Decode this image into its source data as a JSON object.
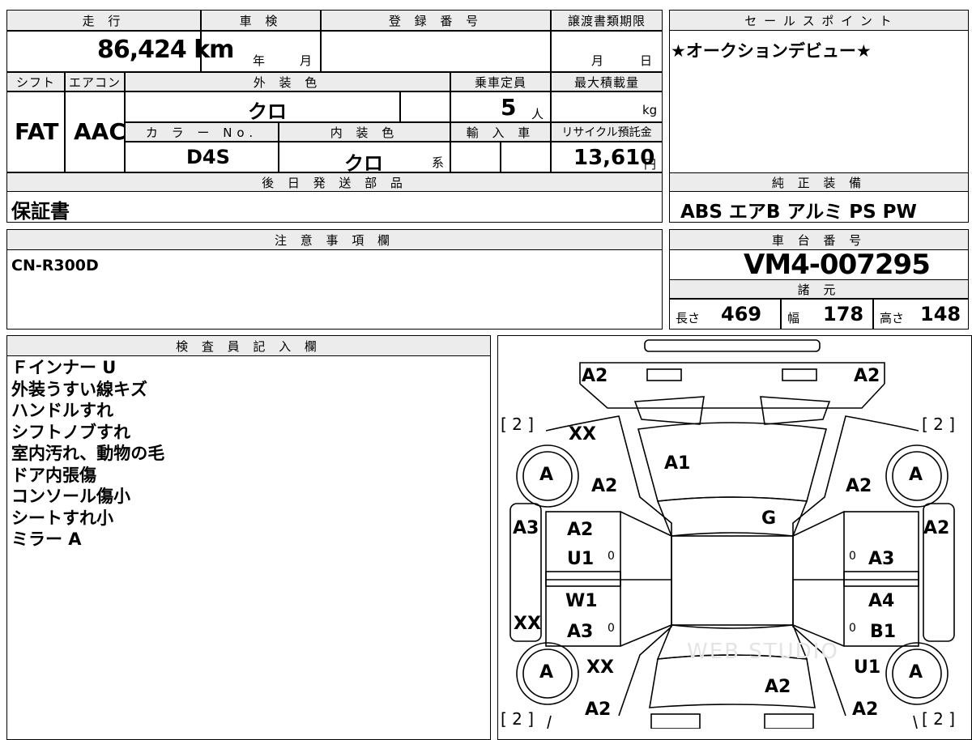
{
  "header": {
    "mileage_label": "走 行",
    "inspection_label": "車 検",
    "reg_number_label": "登 録 番 号",
    "transfer_deadline_label": "譲渡書類期限",
    "sales_point_label": "セ ー ル ス ポ イ ン ト"
  },
  "row1": {
    "mileage": "86,424 km",
    "inspection_year_unit": "年",
    "inspection_month_unit": "月",
    "transfer_month_unit": "月",
    "transfer_day_unit": "日",
    "sales_point": "★オークションデビュー★"
  },
  "labels2": {
    "shift": "シフト",
    "aircon": "エアコン",
    "exterior_color": "外 装 色",
    "capacity": "乗車定員",
    "max_load": "最大積載量",
    "color_no": "カ ラ ー No.",
    "interior_color": "内 装 色",
    "import": "輸 入 車",
    "recycle": "リサイクル預託金"
  },
  "values2": {
    "shift": "FAT",
    "aircon": "AAC",
    "exterior_color": "クロ",
    "capacity": "5",
    "capacity_unit": "人",
    "max_load_unit": "kg",
    "color_no": "D4S",
    "interior_color": "クロ",
    "interior_suffix": "系",
    "recycle": "13,610",
    "recycle_unit": "円"
  },
  "later_parts": {
    "label": "後 日 発 送 部 品",
    "value": "保証書"
  },
  "genuine_equipment": {
    "label": "純 正 装 備",
    "value": "ABS エアB アルミ PS PW"
  },
  "notes": {
    "label": "注 意 事 項 欄",
    "value": "CN-R300D"
  },
  "chassis": {
    "label": "車 台 番 号",
    "value": "VM4-007295"
  },
  "specs": {
    "label": "諸 元",
    "length_label": "長さ",
    "length": "469",
    "width_label": "幅",
    "width": "178",
    "height_label": "高さ",
    "height": "148"
  },
  "inspector": {
    "label": "検 査 員 記 入 欄",
    "lines": [
      "Ｆインナー U",
      "外装うすい線キズ",
      "ハンドルすれ",
      "シフトノブすれ",
      "室内汚れ、動物の毛",
      "ドア内張傷",
      "コンソール傷小",
      "シートすれ小",
      "ミラー A"
    ]
  },
  "diagram": {
    "marks": [
      {
        "id": "front-left-corner",
        "t": "A2"
      },
      {
        "id": "front-right-corner",
        "t": "A2"
      },
      {
        "id": "tire-fl",
        "t": "[ 2 ]"
      },
      {
        "id": "tire-fr",
        "t": "[ 2 ]"
      },
      {
        "id": "tire-rl",
        "t": "[ 2 ]"
      },
      {
        "id": "tire-rr",
        "t": "[ 2 ]"
      },
      {
        "id": "hood-left",
        "t": "XX"
      },
      {
        "id": "hood",
        "t": "A1"
      },
      {
        "id": "fender-fl",
        "t": "A2"
      },
      {
        "id": "fender-fr",
        "t": "A2"
      },
      {
        "id": "windshield",
        "t": "G"
      },
      {
        "id": "pillar-left",
        "t": "A3"
      },
      {
        "id": "pillar-right",
        "t": "A2"
      },
      {
        "id": "door-fl-1",
        "t": "A2"
      },
      {
        "id": "door-fl-2",
        "t": "U1"
      },
      {
        "id": "door-fr",
        "t": "A3"
      },
      {
        "id": "door-rl-1",
        "t": "W1"
      },
      {
        "id": "door-rl-2",
        "t": "A3"
      },
      {
        "id": "door-rr-1",
        "t": "A4"
      },
      {
        "id": "door-rr-2",
        "t": "B1"
      },
      {
        "id": "side-rl",
        "t": "XX"
      },
      {
        "id": "quarter-rl",
        "t": "XX"
      },
      {
        "id": "quarter-rr",
        "t": "U1"
      },
      {
        "id": "trunk",
        "t": "A2"
      },
      {
        "id": "rear-left",
        "t": "A2"
      },
      {
        "id": "rear-right",
        "t": "A2"
      },
      {
        "id": "mirror-fl",
        "t": "0"
      },
      {
        "id": "mirror-fr",
        "t": "0"
      },
      {
        "id": "mirror-rl",
        "t": "0"
      },
      {
        "id": "mirror-rr",
        "t": "0"
      }
    ],
    "wheels": [
      "A",
      "A",
      "A",
      "A"
    ],
    "watermark": "WEB STUDIO"
  }
}
